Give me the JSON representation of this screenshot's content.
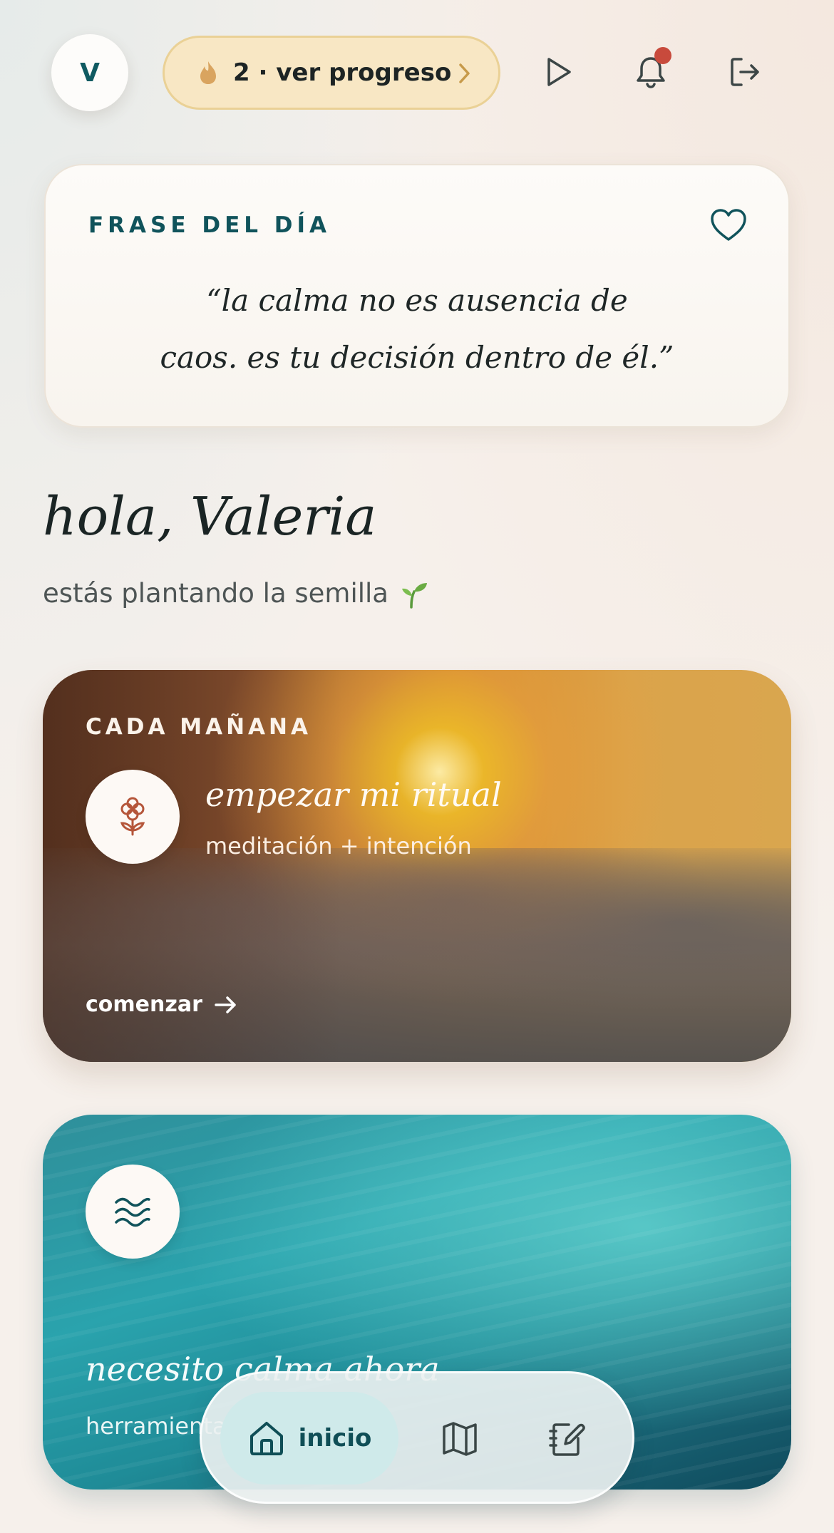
{
  "header": {
    "avatar_initial": "V",
    "streak_label": "2 · ver progreso",
    "icons": [
      "flame-icon",
      "chevron-right-icon",
      "play-icon",
      "bell-icon",
      "logout-icon"
    ],
    "has_notification": true
  },
  "quote": {
    "label": "FRASE DEL DÍA",
    "text_line1": "“la calma no es ausencia de",
    "text_line2": "caos. es tu decisión dentro de él.”",
    "icon": "heart-icon"
  },
  "greeting": {
    "title": "hola, Valeria",
    "subtitle": "estás plantando la semilla"
  },
  "ritual_card": {
    "label": "CADA MAÑANA",
    "title": "empezar mi ritual",
    "subtitle": "meditación + intención",
    "cta": "comenzar",
    "icon": "flower-icon"
  },
  "calm_card": {
    "title": "necesito calma ahora",
    "subtitle": "herramientas",
    "icon": "waves-icon"
  },
  "nav": {
    "home_label": "inicio",
    "items": [
      "home-icon",
      "map-icon",
      "journal-icon"
    ]
  },
  "colors": {
    "accent_teal": "#10535b",
    "streak_bg": "#f8e7c4",
    "notification": "#c84a3c",
    "flower": "#b5563a"
  }
}
